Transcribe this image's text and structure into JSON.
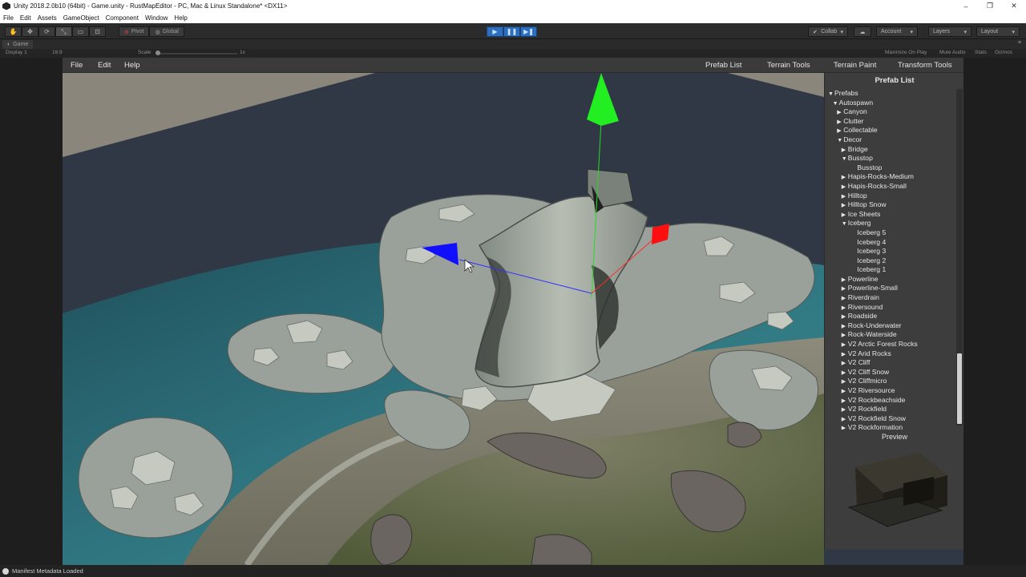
{
  "window": {
    "title": "Unity 2018.2.0b10 (64bit) - Game.unity - RustMapEditor - PC, Mac & Linux Standalone* <DX11>",
    "controls": [
      "–",
      "❐",
      "✕"
    ]
  },
  "menu": [
    "File",
    "Edit",
    "Assets",
    "GameObject",
    "Component",
    "Window",
    "Help"
  ],
  "toolbar": {
    "pivot": "Pivot",
    "global": "Global",
    "collab": "Collab",
    "account": "Account",
    "layers": "Layers",
    "layout": "Layout"
  },
  "game_tab": {
    "label": "Game",
    "display": "Display 1",
    "aspect": "16:9",
    "scale_label": "Scale",
    "scale_value": "1x",
    "maximize": "Maximize On Play",
    "mute": "Mute Audio",
    "stats": "Stats",
    "gizmos": "Gizmos"
  },
  "app_menu": {
    "left": [
      "File",
      "Edit",
      "Help"
    ],
    "right": [
      "Prefab List",
      "Terrain Tools",
      "Terrain Paint",
      "Transform Tools"
    ]
  },
  "prefab_panel": {
    "title": "Prefab List",
    "preview_label": "Preview",
    "tree": [
      {
        "label": "Prefabs",
        "depth": 0,
        "state": "open"
      },
      {
        "label": "Autospawn",
        "depth": 1,
        "state": "open"
      },
      {
        "label": "Canyon",
        "depth": 2,
        "state": "closed"
      },
      {
        "label": "Clutter",
        "depth": 2,
        "state": "closed"
      },
      {
        "label": "Collectable",
        "depth": 2,
        "state": "closed"
      },
      {
        "label": "Decor",
        "depth": 2,
        "state": "open"
      },
      {
        "label": "Bridge",
        "depth": 3,
        "state": "closed"
      },
      {
        "label": "Busstop",
        "depth": 3,
        "state": "open"
      },
      {
        "label": "Busstop",
        "depth": 4,
        "state": "leaf"
      },
      {
        "label": "Hapis-Rocks-Medium",
        "depth": 3,
        "state": "closed"
      },
      {
        "label": "Hapis-Rocks-Small",
        "depth": 3,
        "state": "closed"
      },
      {
        "label": "Hilltop",
        "depth": 3,
        "state": "closed"
      },
      {
        "label": "Hilltop Snow",
        "depth": 3,
        "state": "closed"
      },
      {
        "label": "Ice Sheets",
        "depth": 3,
        "state": "closed"
      },
      {
        "label": "Iceberg",
        "depth": 3,
        "state": "open"
      },
      {
        "label": "Iceberg 5",
        "depth": 4,
        "state": "leaf"
      },
      {
        "label": "Iceberg 4",
        "depth": 4,
        "state": "leaf"
      },
      {
        "label": "Iceberg 3",
        "depth": 4,
        "state": "leaf"
      },
      {
        "label": "Iceberg 2",
        "depth": 4,
        "state": "leaf"
      },
      {
        "label": "Iceberg 1",
        "depth": 4,
        "state": "leaf"
      },
      {
        "label": "Powerline",
        "depth": 3,
        "state": "closed"
      },
      {
        "label": "Powerline-Small",
        "depth": 3,
        "state": "closed"
      },
      {
        "label": "Riverdrain",
        "depth": 3,
        "state": "closed"
      },
      {
        "label": "Riversound",
        "depth": 3,
        "state": "closed"
      },
      {
        "label": "Roadside",
        "depth": 3,
        "state": "closed"
      },
      {
        "label": "Rock-Underwater",
        "depth": 3,
        "state": "closed"
      },
      {
        "label": "Rock-Waterside",
        "depth": 3,
        "state": "closed"
      },
      {
        "label": "V2 Arctic Forest Rocks",
        "depth": 3,
        "state": "closed"
      },
      {
        "label": "V2 Arid Rocks",
        "depth": 3,
        "state": "closed"
      },
      {
        "label": "V2 Cliff",
        "depth": 3,
        "state": "closed"
      },
      {
        "label": "V2 Cliff Snow",
        "depth": 3,
        "state": "closed"
      },
      {
        "label": "V2 Cliffmicro",
        "depth": 3,
        "state": "closed"
      },
      {
        "label": "V2 Riversource",
        "depth": 3,
        "state": "closed"
      },
      {
        "label": "V2 Rockbeachside",
        "depth": 3,
        "state": "closed"
      },
      {
        "label": "V2 Rockfield",
        "depth": 3,
        "state": "closed"
      },
      {
        "label": "V2 Rockfield Snow",
        "depth": 3,
        "state": "closed"
      },
      {
        "label": "V2 Rockformation",
        "depth": 3,
        "state": "closed"
      }
    ]
  },
  "status": "Manifest Metadata Loaded",
  "colors": {
    "play_blue": "#2c6fbf",
    "gizmo_x": "#ff1a1a",
    "gizmo_y": "#22dd22",
    "gizmo_z": "#1a1aff",
    "water": "#2f6f78",
    "sky": "#313845"
  }
}
